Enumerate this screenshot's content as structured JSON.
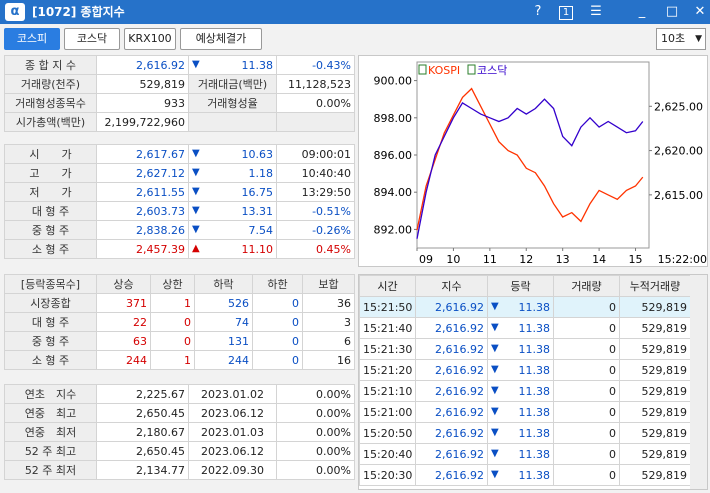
{
  "window": {
    "title": "[1072] 종합지수",
    "help": "?",
    "page": "1"
  },
  "tabs": [
    {
      "label": "코스피"
    },
    {
      "label": "코스닥"
    },
    {
      "label": "KRX100"
    },
    {
      "label": "예상체결가"
    }
  ],
  "interval": "10초",
  "summary": {
    "index_label": "종 합 지 수",
    "index": "2,616.92",
    "index_change": "11.38",
    "index_rate": "-0.43%",
    "vol_label": "거래량(천주)",
    "vol": "529,819",
    "amt_label": "거래대금(백만)",
    "amt": "11,128,523",
    "form_cnt_label": "거래형성종목수",
    "form_cnt": "933",
    "form_rate_label": "거래형성율",
    "form_rate": "0.00%",
    "mcap_label": "시가총액(백만)",
    "mcap": "2,199,722,960"
  },
  "prices": [
    {
      "label": "시　　가",
      "value": "2,617.67",
      "dir": "down",
      "change": "10.63",
      "extra": "09:00:01"
    },
    {
      "label": "고　　가",
      "value": "2,627.12",
      "dir": "down",
      "change": "1.18",
      "extra": "10:40:40"
    },
    {
      "label": "저　　가",
      "value": "2,611.55",
      "dir": "down",
      "change": "16.75",
      "extra": "13:29:50"
    },
    {
      "label": "대 형 주",
      "value": "2,603.73",
      "dir": "down",
      "change": "13.31",
      "extra": "-0.51%"
    },
    {
      "label": "중 형 주",
      "value": "2,838.26",
      "dir": "down",
      "change": "7.54",
      "extra": "-0.26%"
    },
    {
      "label": "소 형 주",
      "value": "2,457.39",
      "dir": "up",
      "change": "11.10",
      "extra": "0.45%"
    }
  ],
  "breadth": {
    "headers": [
      "[등락종목수]",
      "상승",
      "상한",
      "하락",
      "하한",
      "보합"
    ],
    "rows": [
      {
        "label": "시장종합",
        "c": [
          "371",
          "1",
          "526",
          "0",
          "36"
        ]
      },
      {
        "label": "대 형 주",
        "c": [
          "22",
          "0",
          "74",
          "0",
          "3"
        ]
      },
      {
        "label": "중 형 주",
        "c": [
          "63",
          "0",
          "131",
          "0",
          "6"
        ]
      },
      {
        "label": "소 형 주",
        "c": [
          "244",
          "1",
          "244",
          "0",
          "16"
        ]
      }
    ]
  },
  "yearly": [
    {
      "label": "연초　지수",
      "v": "2,225.67",
      "d": "2023.01.02",
      "r": "0.00%"
    },
    {
      "label": "연중　최고",
      "v": "2,650.45",
      "d": "2023.06.12",
      "r": "0.00%"
    },
    {
      "label": "연중　최저",
      "v": "2,180.67",
      "d": "2023.01.03",
      "r": "0.00%"
    },
    {
      "label": "52 주 최고",
      "v": "2,650.45",
      "d": "2023.06.12",
      "r": "0.00%"
    },
    {
      "label": "52 주 최저",
      "v": "2,134.77",
      "d": "2022.09.30",
      "r": "0.00%"
    }
  ],
  "ticks": {
    "headers": [
      "시간",
      "지수",
      "등락",
      "거래량",
      "누적거래량"
    ],
    "rows": [
      {
        "t": "15:21:50",
        "i": "2,616.92",
        "c": "11.38",
        "v": "0",
        "a": "529,819"
      },
      {
        "t": "15:21:40",
        "i": "2,616.92",
        "c": "11.38",
        "v": "0",
        "a": "529,819"
      },
      {
        "t": "15:21:30",
        "i": "2,616.92",
        "c": "11.38",
        "v": "0",
        "a": "529,819"
      },
      {
        "t": "15:21:20",
        "i": "2,616.92",
        "c": "11.38",
        "v": "0",
        "a": "529,819"
      },
      {
        "t": "15:21:10",
        "i": "2,616.92",
        "c": "11.38",
        "v": "0",
        "a": "529,819"
      },
      {
        "t": "15:21:00",
        "i": "2,616.92",
        "c": "11.38",
        "v": "0",
        "a": "529,819"
      },
      {
        "t": "15:20:50",
        "i": "2,616.92",
        "c": "11.38",
        "v": "0",
        "a": "529,819"
      },
      {
        "t": "15:20:40",
        "i": "2,616.92",
        "c": "11.38",
        "v": "0",
        "a": "529,819"
      },
      {
        "t": "15:20:30",
        "i": "2,616.92",
        "c": "11.38",
        "v": "0",
        "a": "529,819"
      }
    ]
  },
  "colors": {
    "up": "#d40000",
    "down": "#0a4fc4",
    "kospi": "#ff3300",
    "kosdaq": "#3300cc"
  },
  "chart_data": {
    "type": "line",
    "legend": [
      "KOSPI",
      "코스닥"
    ],
    "left_axis": {
      "ticks": [
        "900.00",
        "898.00",
        "896.00",
        "894.00",
        "892.00"
      ],
      "ylim": [
        891.0,
        901.0
      ]
    },
    "right_axis": {
      "ticks": [
        "2,625.00",
        "2,620.00",
        "2,615.00"
      ],
      "ylim": [
        2609.0,
        2630.0
      ]
    },
    "x_ticks": [
      "09",
      "10",
      "11",
      "12",
      "13",
      "14",
      "15"
    ],
    "x_end_label": "15:22:00",
    "series": [
      {
        "name": "KOSPI",
        "axis": "right",
        "x": [
          9.0,
          9.25,
          9.5,
          9.75,
          10.0,
          10.25,
          10.5,
          10.75,
          11.0,
          11.25,
          11.5,
          11.75,
          12.0,
          12.25,
          12.5,
          12.75,
          13.0,
          13.25,
          13.5,
          13.75,
          14.0,
          14.25,
          14.5,
          14.75,
          15.0,
          15.2
        ],
        "values": [
          2611,
          2616,
          2619,
          2622,
          2624,
          2626,
          2627,
          2625,
          2623,
          2621,
          2620,
          2619.5,
          2618,
          2617.5,
          2616,
          2614,
          2612.5,
          2613,
          2612,
          2614,
          2615.5,
          2615,
          2614.5,
          2615.5,
          2616,
          2617
        ]
      },
      {
        "name": "코스닥",
        "axis": "left",
        "x": [
          9.0,
          9.25,
          9.5,
          9.75,
          10.0,
          10.25,
          10.5,
          10.75,
          11.0,
          11.25,
          11.5,
          11.75,
          12.0,
          12.25,
          12.5,
          12.75,
          13.0,
          13.25,
          13.5,
          13.75,
          14.0,
          14.25,
          14.5,
          14.75,
          15.0,
          15.2
        ],
        "values": [
          891.5,
          894,
          896,
          897,
          898,
          898.8,
          898.5,
          898.2,
          898,
          897.8,
          898,
          898.5,
          898.2,
          898.5,
          899,
          898.5,
          897,
          896.5,
          897.5,
          898,
          897.5,
          897.8,
          897.5,
          897.2,
          897.3,
          897.8
        ]
      }
    ]
  }
}
